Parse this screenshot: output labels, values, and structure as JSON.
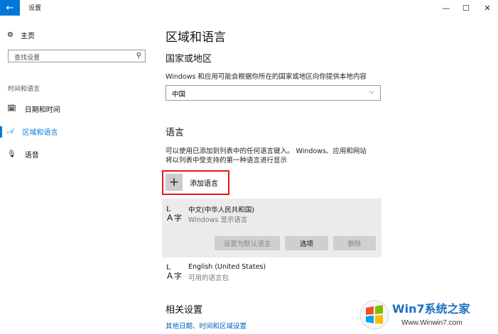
{
  "window": {
    "title": "设置",
    "back_icon": "back-arrow-icon",
    "controls": {
      "minimize": "—",
      "maximize": "☐",
      "close": "✕"
    }
  },
  "sidebar": {
    "home_label": "主页",
    "search_placeholder": "查找设置",
    "section_title": "时间和语言",
    "items": [
      {
        "label": "日期和时间",
        "icon": "calendar-clock-icon",
        "active": false
      },
      {
        "label": "区域和语言",
        "icon": "region-language-icon",
        "active": true
      },
      {
        "label": "语音",
        "icon": "microphone-icon",
        "active": false
      }
    ]
  },
  "main": {
    "title": "区域和语言",
    "country_heading": "国家或地区",
    "country_desc": "Windows 和应用可能会根据你所在的国家或地区向你提供本地内容",
    "country_value": "中国",
    "language_heading": "语言",
    "language_desc_line1": "可以使用已添加到列表中的任何语言键入。 Windows、应用和网站",
    "language_desc_line2": "将以列表中受支持的第一种语言进行显示",
    "add_language_label": "添加语言",
    "languages": [
      {
        "name": "中文(中华人民共和国)",
        "sub": "Windows 显示语言"
      },
      {
        "name": "English (United States)",
        "sub": "可用的语言包"
      }
    ],
    "buttons": {
      "set_default": "设置为默认语言",
      "options": "选项",
      "remove": "删除"
    },
    "related_heading": "相关设置",
    "related_link": "其他日期、时间和区域设置"
  },
  "watermark": {
    "text": "Win7系统之家",
    "url": "Www.Winwin7.com"
  },
  "colors": {
    "accent": "#0078d7",
    "highlight": "#e21a1a",
    "card": "#ebebeb"
  }
}
